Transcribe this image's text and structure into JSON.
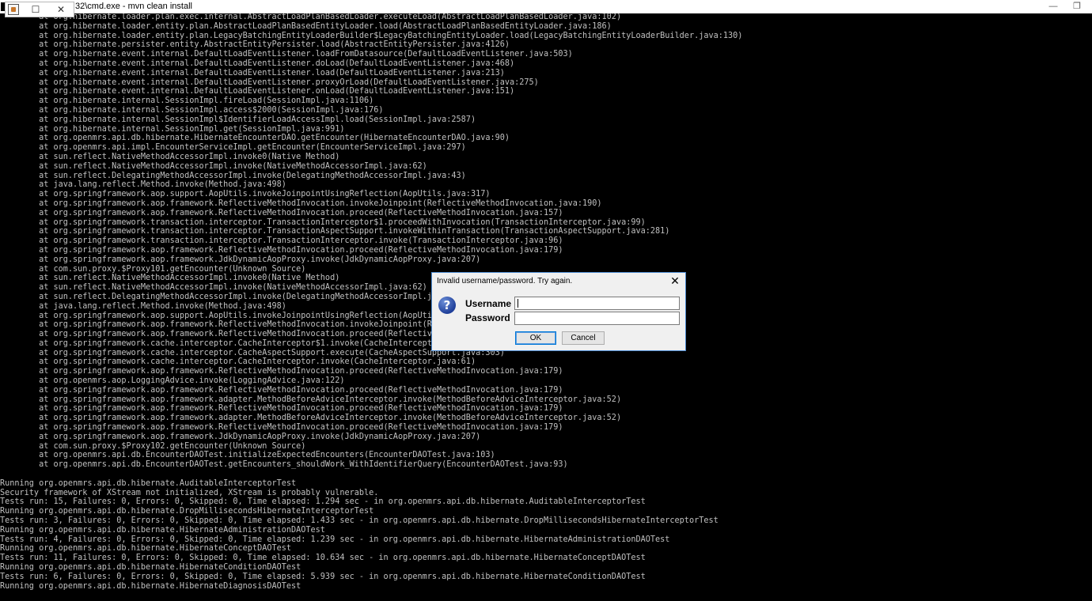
{
  "window": {
    "title": "32\\cmd.exe - mvn  clean install",
    "minimize_glyph": "—",
    "restore_glyph": "❐"
  },
  "mini_window": {
    "maximize_glyph": "☐",
    "close_glyph": "✕"
  },
  "console_lines": [
    "        at org.hibernate.loader.plan.exec.internal.AbstractLoadPlanBasedLoader.executeLoad(AbstractLoadPlanBasedLoader.java:102)",
    "        at org.hibernate.loader.entity.plan.AbstractLoadPlanBasedEntityLoader.load(AbstractLoadPlanBasedEntityLoader.java:186)",
    "        at org.hibernate.loader.entity.plan.LegacyBatchingEntityLoaderBuilder$LegacyBatchingEntityLoader.load(LegacyBatchingEntityLoaderBuilder.java:130)",
    "        at org.hibernate.persister.entity.AbstractEntityPersister.load(AbstractEntityPersister.java:4126)",
    "        at org.hibernate.event.internal.DefaultLoadEventListener.loadFromDatasource(DefaultLoadEventListener.java:503)",
    "        at org.hibernate.event.internal.DefaultLoadEventListener.doLoad(DefaultLoadEventListener.java:468)",
    "        at org.hibernate.event.internal.DefaultLoadEventListener.load(DefaultLoadEventListener.java:213)",
    "        at org.hibernate.event.internal.DefaultLoadEventListener.proxyOrLoad(DefaultLoadEventListener.java:275)",
    "        at org.hibernate.event.internal.DefaultLoadEventListener.onLoad(DefaultLoadEventListener.java:151)",
    "        at org.hibernate.internal.SessionImpl.fireLoad(SessionImpl.java:1106)",
    "        at org.hibernate.internal.SessionImpl.access$2000(SessionImpl.java:176)",
    "        at org.hibernate.internal.SessionImpl$IdentifierLoadAccessImpl.load(SessionImpl.java:2587)",
    "        at org.hibernate.internal.SessionImpl.get(SessionImpl.java:991)",
    "        at org.openmrs.api.db.hibernate.HibernateEncounterDAO.getEncounter(HibernateEncounterDAO.java:90)",
    "        at org.openmrs.api.impl.EncounterServiceImpl.getEncounter(EncounterServiceImpl.java:297)",
    "        at sun.reflect.NativeMethodAccessorImpl.invoke0(Native Method)",
    "        at sun.reflect.NativeMethodAccessorImpl.invoke(NativeMethodAccessorImpl.java:62)",
    "        at sun.reflect.DelegatingMethodAccessorImpl.invoke(DelegatingMethodAccessorImpl.java:43)",
    "        at java.lang.reflect.Method.invoke(Method.java:498)",
    "        at org.springframework.aop.support.AopUtils.invokeJoinpointUsingReflection(AopUtils.java:317)",
    "        at org.springframework.aop.framework.ReflectiveMethodInvocation.invokeJoinpoint(ReflectiveMethodInvocation.java:190)",
    "        at org.springframework.aop.framework.ReflectiveMethodInvocation.proceed(ReflectiveMethodInvocation.java:157)",
    "        at org.springframework.transaction.interceptor.TransactionInterceptor$1.proceedWithInvocation(TransactionInterceptor.java:99)",
    "        at org.springframework.transaction.interceptor.TransactionAspectSupport.invokeWithinTransaction(TransactionAspectSupport.java:281)",
    "        at org.springframework.transaction.interceptor.TransactionInterceptor.invoke(TransactionInterceptor.java:96)",
    "        at org.springframework.aop.framework.ReflectiveMethodInvocation.proceed(ReflectiveMethodInvocation.java:179)",
    "        at org.springframework.aop.framework.JdkDynamicAopProxy.invoke(JdkDynamicAopProxy.java:207)",
    "        at com.sun.proxy.$Proxy101.getEncounter(Unknown Source)",
    "        at sun.reflect.NativeMethodAccessorImpl.invoke0(Native Method)",
    "        at sun.reflect.NativeMethodAccessorImpl.invoke(NativeMethodAccessorImpl.java:62)",
    "        at sun.reflect.DelegatingMethodAccessorImpl.invoke(DelegatingMethodAccessorImpl.java:43)",
    "        at java.lang.reflect.Method.invoke(Method.java:498)",
    "        at org.springframework.aop.support.AopUtils.invokeJoinpointUsingReflection(AopUtils.java:317)",
    "        at org.springframework.aop.framework.ReflectiveMethodInvocation.invokeJoinpoint(ReflectiveMethodInvocation.java:190)",
    "        at org.springframework.aop.framework.ReflectiveMethodInvocation.proceed(ReflectiveMethodInvocation.java:157)",
    "        at org.springframework.cache.interceptor.CacheInterceptor$1.invoke(CacheInterceptor.java:52)",
    "        at org.springframework.cache.interceptor.CacheAspectSupport.execute(CacheAspectSupport.java:303)",
    "        at org.springframework.cache.interceptor.CacheInterceptor.invoke(CacheInterceptor.java:61)",
    "        at org.springframework.aop.framework.ReflectiveMethodInvocation.proceed(ReflectiveMethodInvocation.java:179)",
    "        at org.openmrs.aop.LoggingAdvice.invoke(LoggingAdvice.java:122)",
    "        at org.springframework.aop.framework.ReflectiveMethodInvocation.proceed(ReflectiveMethodInvocation.java:179)",
    "        at org.springframework.aop.framework.adapter.MethodBeforeAdviceInterceptor.invoke(MethodBeforeAdviceInterceptor.java:52)",
    "        at org.springframework.aop.framework.ReflectiveMethodInvocation.proceed(ReflectiveMethodInvocation.java:179)",
    "        at org.springframework.aop.framework.adapter.MethodBeforeAdviceInterceptor.invoke(MethodBeforeAdviceInterceptor.java:52)",
    "        at org.springframework.aop.framework.ReflectiveMethodInvocation.proceed(ReflectiveMethodInvocation.java:179)",
    "        at org.springframework.aop.framework.JdkDynamicAopProxy.invoke(JdkDynamicAopProxy.java:207)",
    "        at com.sun.proxy.$Proxy102.getEncounter(Unknown Source)",
    "        at org.openmrs.api.db.EncounterDAOTest.initializeExpectedEncounters(EncounterDAOTest.java:103)",
    "        at org.openmrs.api.db.EncounterDAOTest.getEncounters_shouldWork_WithIdentifierQuery(EncounterDAOTest.java:93)",
    "",
    "Running org.openmrs.api.db.hibernate.AuditableInterceptorTest",
    "Security framework of XStream not initialized, XStream is probably vulnerable.",
    "Tests run: 15, Failures: 0, Errors: 0, Skipped: 0, Time elapsed: 1.294 sec - in org.openmrs.api.db.hibernate.AuditableInterceptorTest",
    "Running org.openmrs.api.db.hibernate.DropMillisecondsHibernateInterceptorTest",
    "Tests run: 3, Failures: 0, Errors: 0, Skipped: 0, Time elapsed: 1.433 sec - in org.openmrs.api.db.hibernate.DropMillisecondsHibernateInterceptorTest",
    "Running org.openmrs.api.db.hibernate.HibernateAdministrationDAOTest",
    "Tests run: 4, Failures: 0, Errors: 0, Skipped: 0, Time elapsed: 1.239 sec - in org.openmrs.api.db.hibernate.HibernateAdministrationDAOTest",
    "Running org.openmrs.api.db.hibernate.HibernateConceptDAOTest",
    "Tests run: 11, Failures: 0, Errors: 0, Skipped: 0, Time elapsed: 10.634 sec - in org.openmrs.api.db.hibernate.HibernateConceptDAOTest",
    "Running org.openmrs.api.db.hibernate.HibernateConditionDAOTest",
    "Tests run: 6, Failures: 0, Errors: 0, Skipped: 0, Time elapsed: 5.939 sec - in org.openmrs.api.db.hibernate.HibernateConditionDAOTest",
    "Running org.openmrs.api.db.hibernate.HibernateDiagnosisDAOTest"
  ],
  "dialog": {
    "title": "Invalid username/password.  Try again.",
    "close_glyph": "✕",
    "icon_glyph": "?",
    "username_label": "Username",
    "username_value": "",
    "password_label": "Password",
    "password_value": "",
    "ok_label": "OK",
    "cancel_label": "Cancel"
  }
}
